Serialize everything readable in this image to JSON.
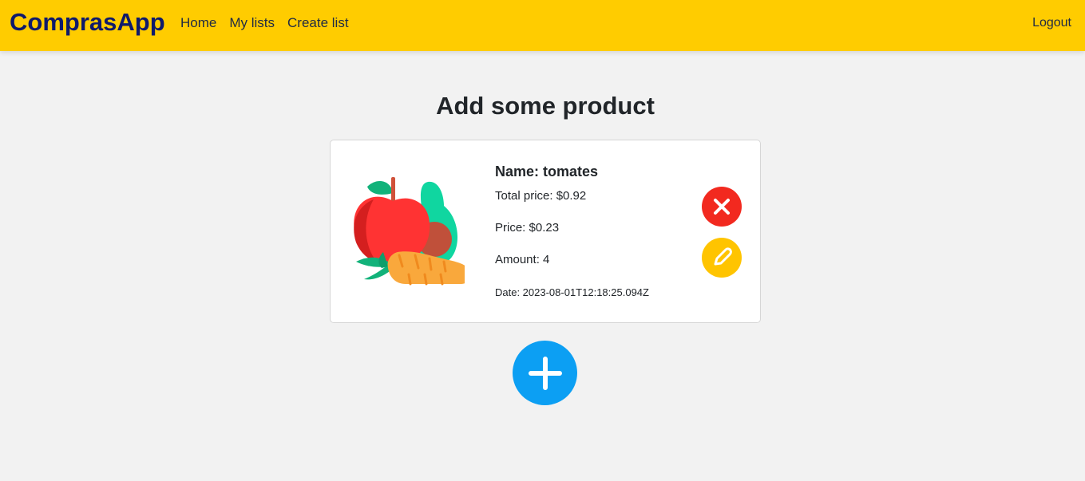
{
  "navbar": {
    "brand": "ComprasApp",
    "links": [
      {
        "label": "Home"
      },
      {
        "label": "My lists"
      },
      {
        "label": "Create list"
      }
    ],
    "logout_label": "Logout",
    "background_color": "#ffcc00",
    "brand_color": "#0f1a6b"
  },
  "page": {
    "title": "Add some product"
  },
  "product": {
    "name": "Name: tomates",
    "total_price": "Total price: $0.92",
    "price": "Price: $0.23",
    "amount": "Amount: 4",
    "date": "Date: 2023-08-01T12:18:25.094Z",
    "image_icon": "vegetables-icon"
  },
  "actions": {
    "delete_icon": "close-icon",
    "delete_color": "#f2291f",
    "edit_icon": "pencil-icon",
    "edit_color": "#ffc400",
    "add_icon": "plus-icon",
    "add_color": "#0c9ff3"
  }
}
